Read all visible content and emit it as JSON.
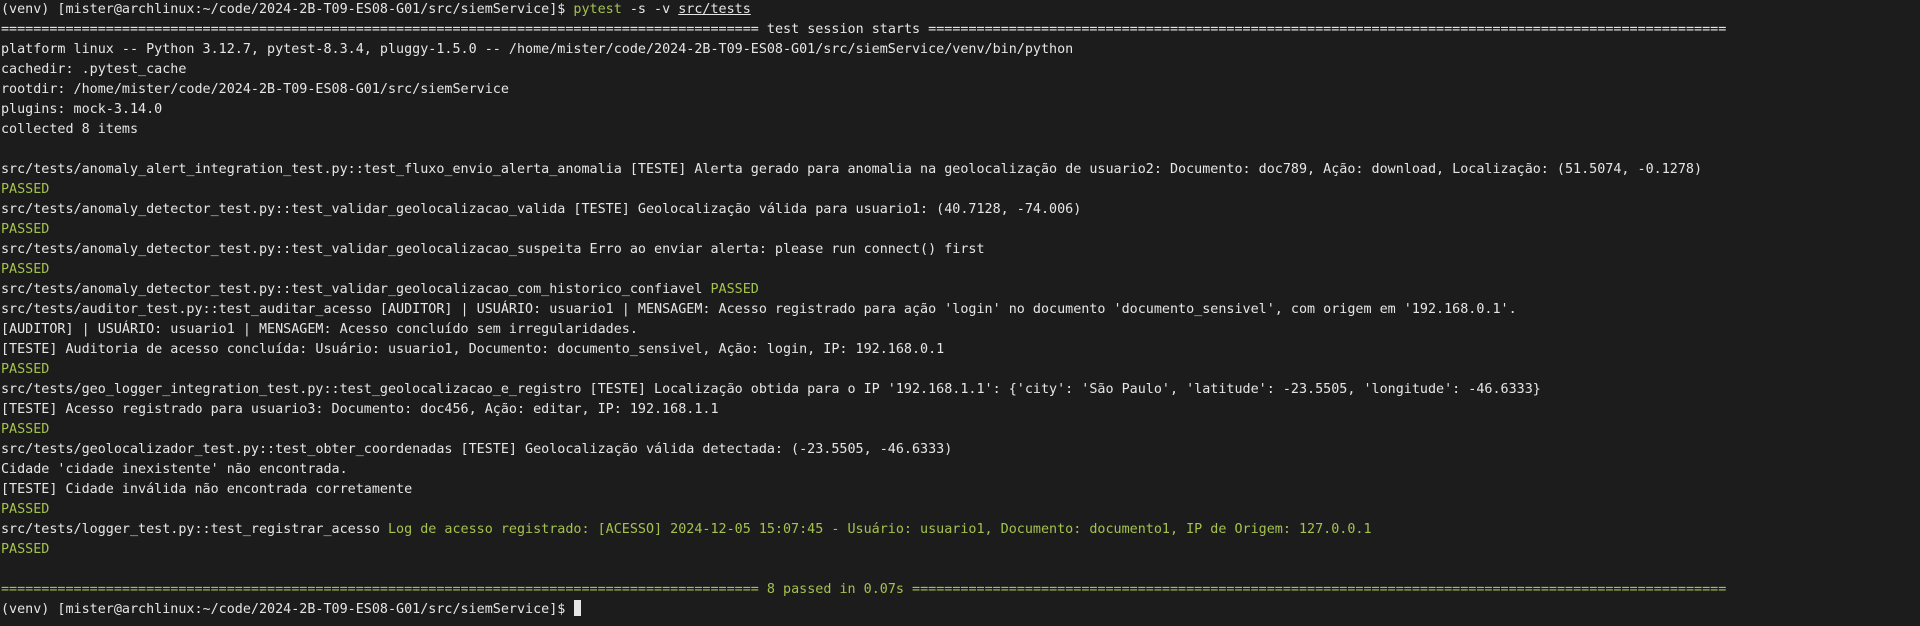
{
  "colors": {
    "background": "#1c1c1c",
    "text": "#e6e6e6",
    "passed_green": "#a4c24e"
  },
  "prompt": "(venv) [mister@archlinux:~/code/2024-2B-T09-ES08-G01/src/siemService]$",
  "command": {
    "program": "pytest",
    "args": "-s -v",
    "path": "src/tests"
  },
  "header": {
    "rule_left": "==============================================================================================",
    "text": " test session starts ",
    "rule_right": "==================================================================================================="
  },
  "session": {
    "platform": "platform linux -- Python 3.12.7, pytest-8.3.4, pluggy-1.5.0 -- /home/mister/code/2024-2B-T09-ES08-G01/src/siemService/venv/bin/python",
    "cachedir": "cachedir: .pytest_cache",
    "rootdir": "rootdir: /home/mister/code/2024-2B-T09-ES08-G01/src/siemService",
    "plugins": "plugins: mock-3.14.0",
    "collected": "collected 8 items"
  },
  "tests": {
    "t1": "src/tests/anomaly_alert_integration_test.py::test_fluxo_envio_alerta_anomalia [TESTE] Alerta gerado para anomalia na geolocalização de usuario2: Documento: doc789, Ação: download, Localização: (51.5074, -0.1278)",
    "t1_status": "PASSED",
    "t2": "src/tests/anomaly_detector_test.py::test_validar_geolocalizacao_valida [TESTE] Geolocalização válida para usuario1: (40.7128, -74.006)",
    "t2_status": "PASSED",
    "t3": "src/tests/anomaly_detector_test.py::test_validar_geolocalizacao_suspeita Erro ao enviar alerta: please run connect() first",
    "t3_status": "PASSED",
    "t4": "src/tests/anomaly_detector_test.py::test_validar_geolocalizacao_com_historico_confiavel ",
    "t4_status": "PASSED",
    "t5": "src/tests/auditor_test.py::test_auditar_acesso [AUDITOR] | USUÁRIO: usuario1 | MENSAGEM: Acesso registrado para ação 'login' no documento 'documento_sensivel', com origem em '192.168.0.1'.",
    "t5_l2": "[AUDITOR] | USUÁRIO: usuario1 | MENSAGEM: Acesso concluído sem irregularidades.",
    "t5_l3": "[TESTE] Auditoria de acesso concluída: Usuário: usuario1, Documento: documento_sensivel, Ação: login, IP: 192.168.0.1",
    "t5_status": "PASSED",
    "t6": "src/tests/geo_logger_integration_test.py::test_geolocalizacao_e_registro [TESTE] Localização obtida para o IP '192.168.1.1': {'city': 'São Paulo', 'latitude': -23.5505, 'longitude': -46.6333}",
    "t6_l2": "[TESTE] Acesso registrado para usuario3: Documento: doc456, Ação: editar, IP: 192.168.1.1",
    "t6_status": "PASSED",
    "t7": "src/tests/geolocalizador_test.py::test_obter_coordenadas [TESTE] Geolocalização válida detectada: (-23.5505, -46.6333)",
    "t7_l2": "Cidade 'cidade inexistente' não encontrada.",
    "t7_l3": "[TESTE] Cidade inválida não encontrada corretamente",
    "t7_status": "PASSED",
    "t8": "src/tests/logger_test.py::test_registrar_acesso ",
    "t8_log": "Log de acesso registrado: [ACESSO] 2024-12-05 15:07:45 - Usuário: usuario1, Documento: documento1, IP de Origem: 127.0.0.1",
    "t8_status": "PASSED"
  },
  "footer": {
    "rule_left": "==============================================================================================",
    "text": " 8 passed in 0.07s ",
    "rule_right": "====================================================================================================="
  }
}
